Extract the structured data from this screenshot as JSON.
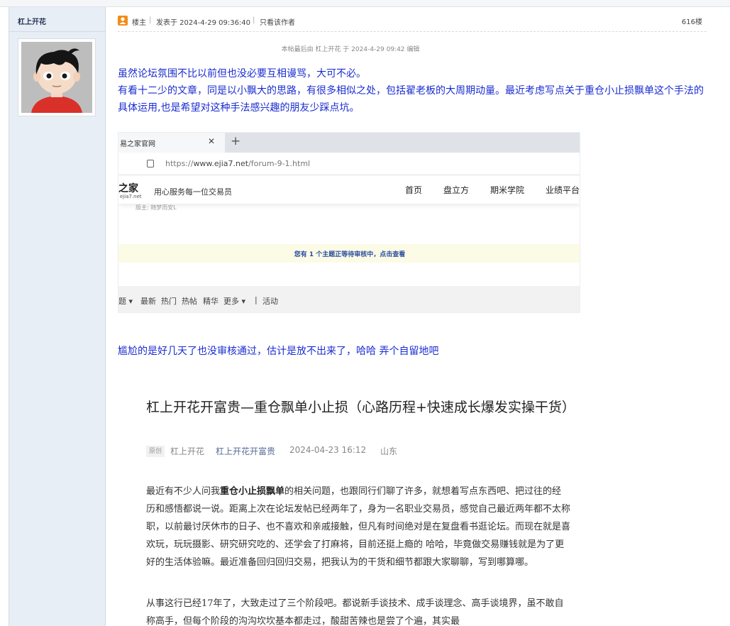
{
  "author": {
    "name": "杠上开花"
  },
  "post_header": {
    "role": "楼主",
    "posted": "发表于 2024-4-29 09:36:40",
    "only_author": "只看该作者",
    "floor": "616楼"
  },
  "edit_note": "本帖最后由 杠上开花 于 2024-4-29 09:42 编辑",
  "body": {
    "line1": "虽然论坛氛围不比以前但也没必要互相谩骂，大可不必。",
    "para2": "有看十二少的文章，同是以小飘大的思路，有很多相似之处，包括翟老板的大周期动量。最近考虑写点关于重仓小止损飘单这个手法的具体运用,也是希望对这种手法感兴趣的朋友少踩点坑。",
    "line3": "尴尬的是好几天了也没审核通过，估计是放不出来了，哈哈  弄个自留地吧"
  },
  "screenshot1": {
    "tab_title": "易之家官网",
    "url_scheme": "https://",
    "url_host": "www.ejia7.net",
    "url_path": "/forum-9-1.html",
    "logo": "易之家",
    "logo_sub": "ejia7.net",
    "slogan": "用心服务每一位交易员",
    "nav": [
      "首页",
      "盘立方",
      "期米学院",
      "业绩平台"
    ],
    "board_mod": "版主: 随梦而安L",
    "notice": "您有 1 个主题正等待审核中，点击查看",
    "filters": [
      "题 ▾",
      "最新",
      "热门",
      "热帖",
      "精华",
      "更多 ▾",
      "|",
      "活动"
    ]
  },
  "article": {
    "title": "杠上开花开富贵—重仓飘单小止损（心路历程+快速成长爆发实操干货）",
    "badge": "原创",
    "author": "杠上开花",
    "account": "杠上开花开富贵",
    "date": "2024-04-23 16:12",
    "location": "山东",
    "p1_pre": "最近有不少人问我",
    "p1_bold": "重仓小止损飘单",
    "p1_post": "的相关问题，也跟同行们聊了许多，就想着写点东西吧、把过往的经历和感悟都说一说。距离上次在论坛发帖已经两年了，身为一名职业交易员，感觉自己最近两年都不太称职，以前最讨厌休市的日子、也不喜欢和亲戚接触，但凡有时间绝对是在复盘看书逛论坛。而现在就是喜欢玩，玩玩摄影、研究研究吃的、还学会了打麻将，目前还挺上瘾的  哈哈，毕竟做交易赚钱就是为了更好的生活体验嘛。最近准备回归回归交易，把我认为的干货和细节都跟大家聊聊，写到哪算哪。",
    "p2": "从事这行已经17年了，大致走过了三个阶段吧。都说新手谈技术、成手谈理念、高手谈境界，虽不敢自称高手，但每个阶段的沟沟坎坎基本都走过，酸甜苦辣也是尝了个遍，其实最"
  }
}
